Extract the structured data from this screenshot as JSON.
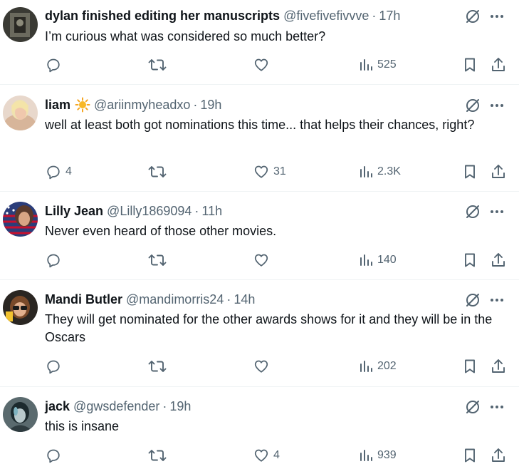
{
  "icons": {
    "reply": "reply-icon",
    "retweet": "retweet-icon",
    "like": "heart-icon",
    "views": "views-chart-icon",
    "bookmark": "bookmark-icon",
    "share": "share-icon",
    "grok": "grok-icon",
    "more": "more-icon"
  },
  "colors": {
    "text": "#0f1419",
    "muted": "#536471",
    "divider": "#eff3f4"
  },
  "tweets": [
    {
      "name": "dylan finished editing her manuscripts",
      "handle": "@fivefivefivvve",
      "sep": "·",
      "time": "17h",
      "text": "I’m curious what was considered so much better?",
      "replies": "",
      "likes": "",
      "views": "525"
    },
    {
      "name": "liam",
      "emoji": "☀",
      "handle": "@ariinmyheadxo",
      "sep": "·",
      "time": "19h",
      "text": "well at least both got nominations this time... that helps their chances, right?",
      "replies": "4",
      "likes": "31",
      "views": "2.3K"
    },
    {
      "name": "Lilly Jean",
      "handle": "@Lilly1869094",
      "sep": "·",
      "time": "11h",
      "text": "Never even heard of those other movies.",
      "replies": "",
      "likes": "",
      "views": "140"
    },
    {
      "name": "Mandi Butler",
      "handle": "@mandimorris24",
      "sep": "·",
      "time": "14h",
      "text": "They will get nominated for the other awards shows for it and they will be in the Oscars",
      "replies": "",
      "likes": "",
      "views": "202"
    },
    {
      "name": "jack",
      "handle": "@gwsdefender",
      "sep": "·",
      "time": "19h",
      "text": "this is insane",
      "replies": "",
      "likes": "4",
      "views": "939"
    }
  ]
}
